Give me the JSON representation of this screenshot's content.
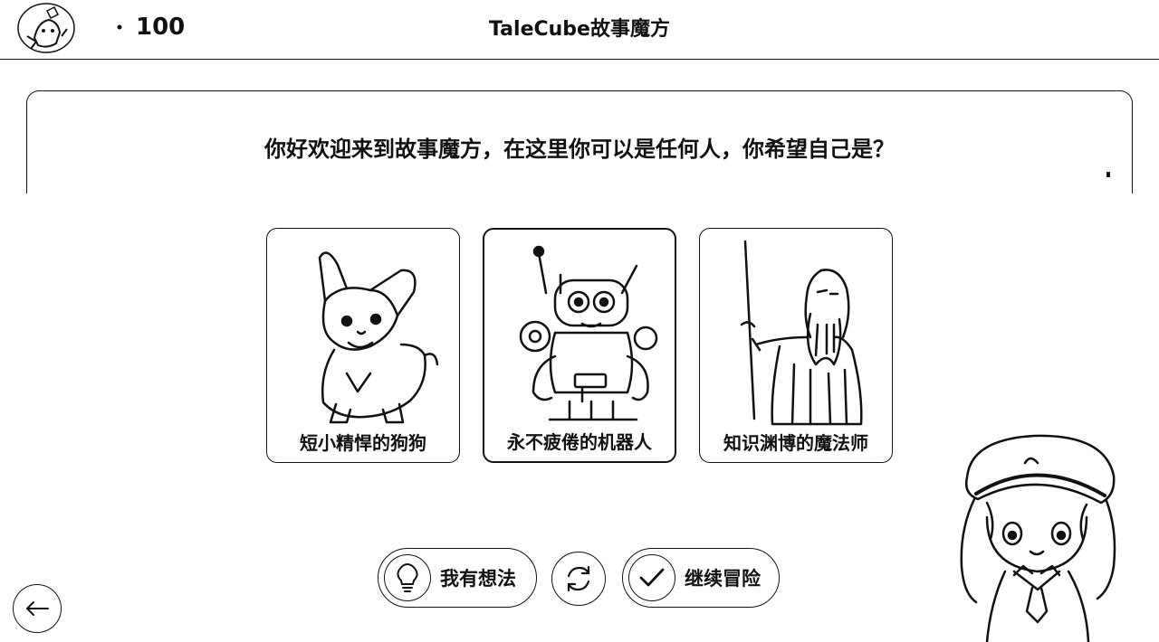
{
  "header": {
    "score": "100",
    "title": "TaleCube故事魔方"
  },
  "dialog": {
    "text": "你好欢迎来到故事魔方，在这里你可以是任何人，你希望自己是？"
  },
  "choices": [
    {
      "label": "短小精悍的狗狗",
      "icon": "corgi-illustration"
    },
    {
      "label": "永不疲倦的机器人",
      "icon": "robot-illustration"
    },
    {
      "label": "知识渊博的魔法师",
      "icon": "wizard-illustration"
    }
  ],
  "actions": {
    "idea_label": "我有想法",
    "continue_label": "继续冒险"
  },
  "colors": {
    "ink": "#111111",
    "background": "#ffffff"
  }
}
